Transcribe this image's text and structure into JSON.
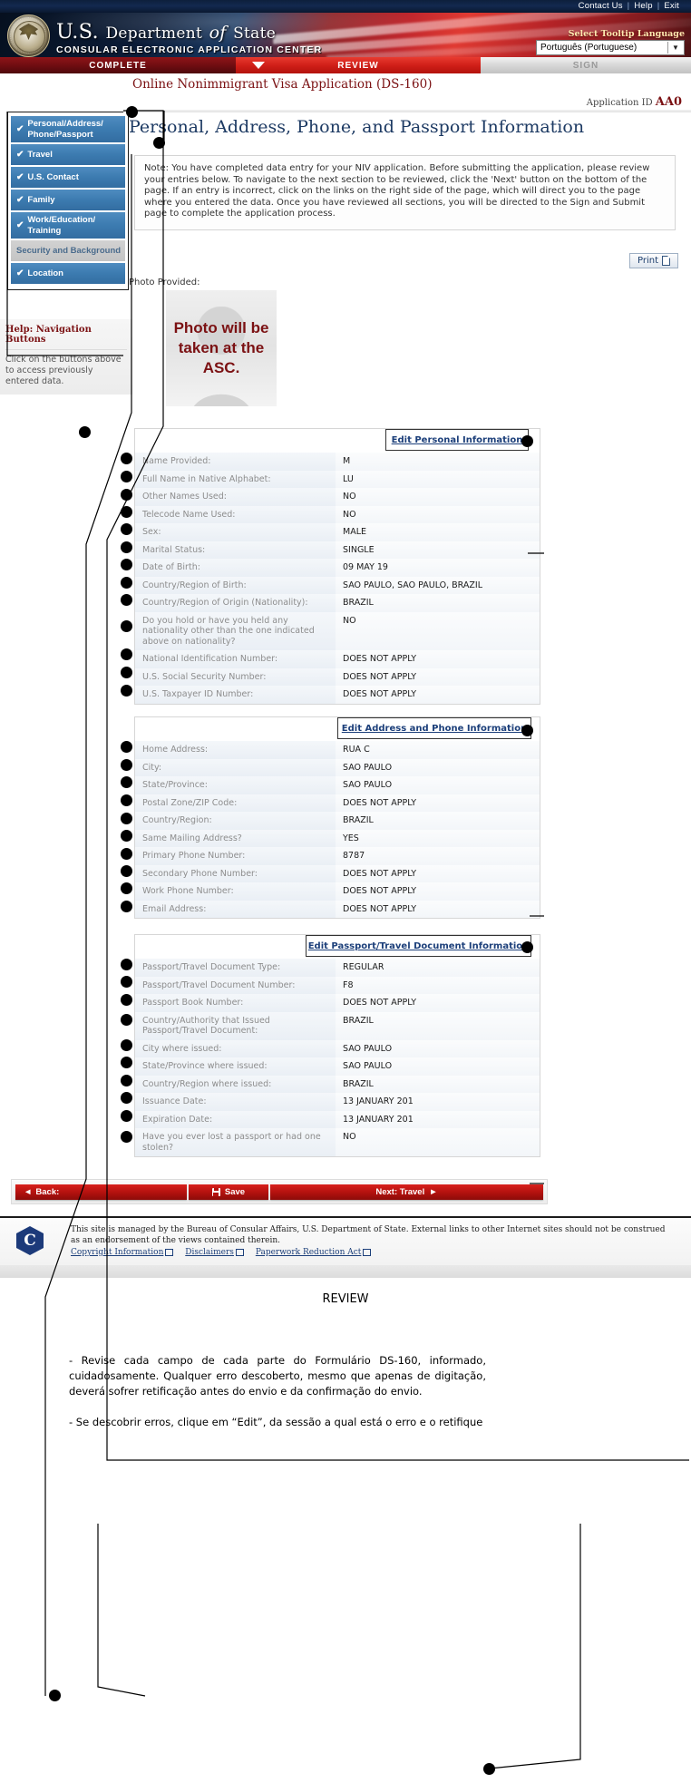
{
  "topbar": {
    "contact": "Contact Us",
    "help": "Help",
    "exit": "Exit",
    "sep": "|"
  },
  "banner": {
    "title_us": "U.S.",
    "title_department": "Department",
    "title_of": "of",
    "title_state": "State",
    "subtitle": "CONSULAR ELECTRONIC APPLICATION CENTER",
    "tooltip_label": "Select Tooltip Language",
    "tooltip_value": "Português (Portuguese)",
    "tooltip_arrow": "chevron-down"
  },
  "tabs": [
    {
      "label": "COMPLETE",
      "state": "complete"
    },
    {
      "label": "REVIEW",
      "state": "active"
    },
    {
      "label": "SIGN",
      "state": "disabled"
    }
  ],
  "sidebar": {
    "items": [
      {
        "label": "Personal/Address/ Phone/Passport",
        "checked": true,
        "active": true
      },
      {
        "label": "Travel",
        "checked": true,
        "active": true
      },
      {
        "label": "U.S. Contact",
        "checked": true,
        "active": true
      },
      {
        "label": "Family",
        "checked": true,
        "active": true
      },
      {
        "label": "Work/Education/ Training",
        "checked": true,
        "active": true
      },
      {
        "label": "Security and Background",
        "checked": false,
        "active": false
      },
      {
        "label": "Location",
        "checked": true,
        "active": true
      }
    ],
    "check_glyph": "✔",
    "help_title": "Help: Navigation Buttons",
    "help_body": "Click on the buttons above to access previously entered data."
  },
  "main": {
    "app_title": "Online Nonimmigrant Visa Application (DS-160)",
    "app_id_label": "Application ID",
    "app_id_value": "AA0",
    "page_heading": "Personal, Address, Phone, and Passport Information",
    "note": "Note: You have completed data entry for your NIV application. Before submitting the application, please review your entries below. To navigate to the next section to be reviewed, click the 'Next' button on the bottom of the page. If an entry is incorrect, click on the links on the right side of the page, which will direct you to the page where you entered the data. Once you have reviewed all sections, you will be directed to the Sign and Submit page to complete the application process.",
    "print_label": "Print",
    "photo_label": "Photo Provided:",
    "photo_placeholder": "Photo will be taken at the ASC."
  },
  "sections": [
    {
      "edit_link": "Edit Personal Information",
      "rows": [
        {
          "label": "Name Provided:",
          "value": "M"
        },
        {
          "label": "Full Name in Native Alphabet:",
          "value": "LU"
        },
        {
          "label": " Other Names Used:",
          "value": "NO"
        },
        {
          "label": "Telecode Name Used:",
          "value": "NO"
        },
        {
          "label": "Sex:",
          "value": "MALE"
        },
        {
          "label": "Marital Status:",
          "value": "SINGLE"
        },
        {
          "label": "Date of Birth:",
          "value": "09 MAY 19"
        },
        {
          "label": "Country/Region of Birth:",
          "value": "SAO PAULO, SAO PAULO, BRAZIL"
        },
        {
          "label": "Country/Region of Origin (Nationality):",
          "value": "BRAZIL"
        },
        {
          "label": "Do you hold or have you held any nationality other than the one indicated above on nationality?",
          "value": "NO"
        },
        {
          "label": "National Identification Number:",
          "value": "DOES NOT APPLY"
        },
        {
          "label": "U.S. Social Security Number:",
          "value": "DOES NOT APPLY"
        },
        {
          "label": "U.S. Taxpayer ID Number:",
          "value": "DOES NOT APPLY"
        }
      ]
    },
    {
      "edit_link": "Edit Address and Phone Information",
      "rows": [
        {
          "label": "Home Address:",
          "value": "RUA C"
        },
        {
          "label": " City:",
          "value": "SAO PAULO"
        },
        {
          "label": " State/Province:",
          "value": "SAO PAULO"
        },
        {
          "label": " Postal Zone/ZIP Code:",
          "value": "DOES NOT APPLY"
        },
        {
          "label": " Country/Region:",
          "value": "BRAZIL"
        },
        {
          "label": "Same Mailing Address?",
          "value": "YES"
        },
        {
          "label": "Primary Phone Number:",
          "value": "8787"
        },
        {
          "label": "Secondary Phone Number:",
          "value": "DOES NOT APPLY"
        },
        {
          "label": "Work Phone Number:",
          "value": "DOES NOT APPLY"
        },
        {
          "label": "Email Address:",
          "value": "DOES NOT APPLY"
        }
      ]
    },
    {
      "edit_link": "Edit Passport/Travel Document Information",
      "rows": [
        {
          "label": "Passport/Travel Document Type:",
          "value": "REGULAR"
        },
        {
          "label": "Passport/Travel Document Number:",
          "value": "F8"
        },
        {
          "label": "Passport Book Number:",
          "value": "DOES NOT APPLY"
        },
        {
          "label": "Country/Authority that Issued Passport/Travel Document:",
          "value": "BRAZIL"
        },
        {
          "label": "City where issued:",
          "value": "SAO PAULO"
        },
        {
          "label": "State/Province where issued:",
          "value": "SAO PAULO"
        },
        {
          "label": "Country/Region where issued:",
          "value": "BRAZIL"
        },
        {
          "label": "Issuance Date:",
          "value": "13 JANUARY 201"
        },
        {
          "label": "Expiration Date:",
          "value": "13 JANUARY 201"
        },
        {
          "label": "Have you ever lost a passport or had one stolen?",
          "value": "NO"
        }
      ]
    }
  ],
  "navbuttons": {
    "back": "Back:",
    "back_arrow": "◄",
    "save": "Save",
    "next": "Next: Travel",
    "next_arrow": "►"
  },
  "footer": {
    "logo_letter": "C",
    "text": "This site is managed by the Bureau of Consular Affairs, U.S. Department of State. External links to other Internet sites should not be construed as an endorsement of the views contained therein.",
    "links": [
      "Copyright Information",
      "Disclaimers",
      "Paperwork Reduction Act"
    ]
  },
  "annotation": {
    "title": "REVIEW",
    "bullet1": "- Revise cada campo de cada parte do Formulário DS-160, informado, cuidadosamente. Qualquer erro descoberto, mesmo que apenas de digitação, deverá sofrer retificação antes do envio e da confirmação do envio.",
    "bullet2": "- Se descobrir erros, clique em “Edit”, da sessão a qual está o erro e o retifique"
  }
}
